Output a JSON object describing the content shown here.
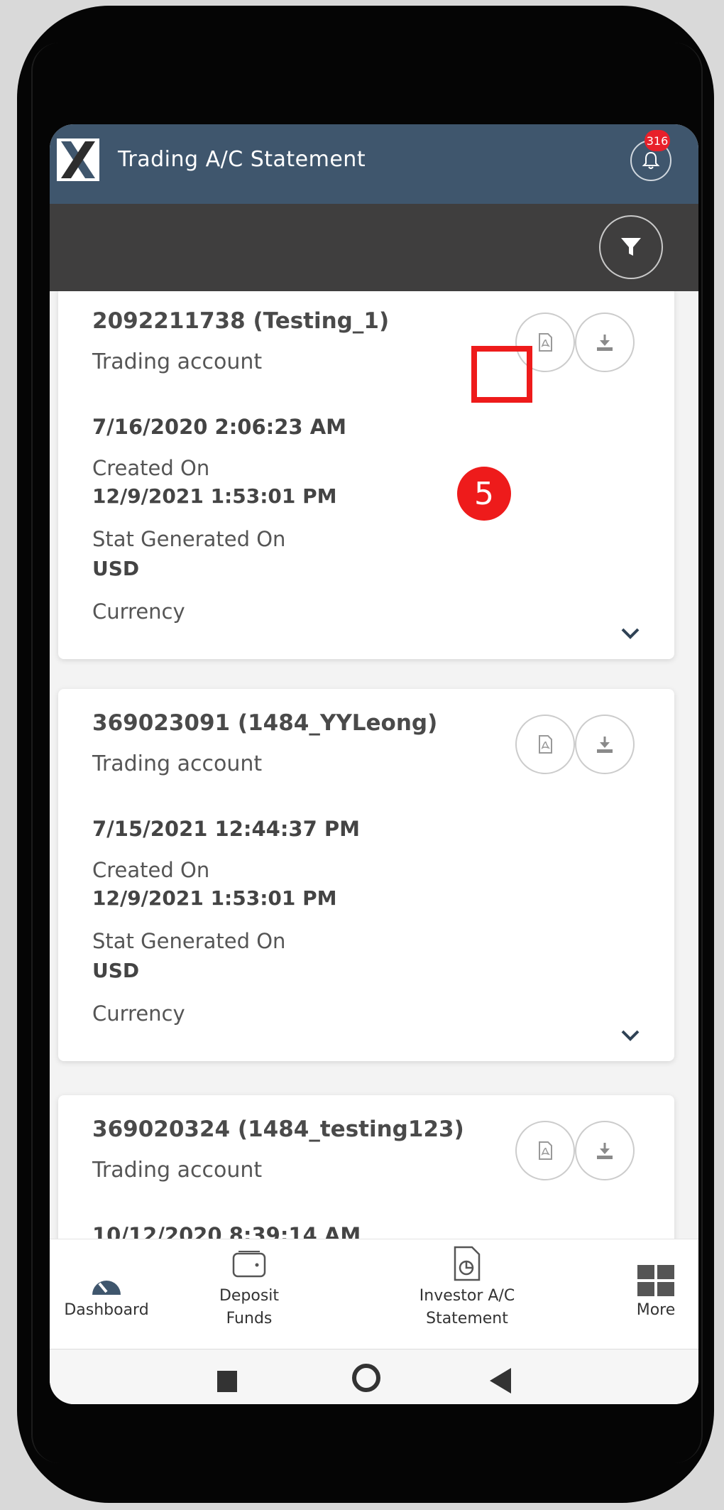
{
  "header": {
    "title": "Trading A/C Statement",
    "notification_count": "316"
  },
  "statements": [
    {
      "account": "2092211738 (Testing_1)",
      "account_type": "Trading account",
      "created_on_value": "7/16/2020 2:06:23 AM",
      "created_on_label": "Created On",
      "generated_on_value": "12/9/2021 1:53:01 PM",
      "generated_on_label": "Stat Generated On",
      "currency_value": "USD",
      "currency_label": "Currency"
    },
    {
      "account": "369023091 (1484_YYLeong)",
      "account_type": "Trading account",
      "created_on_value": "7/15/2021 12:44:37 PM",
      "created_on_label": "Created On",
      "generated_on_value": "12/9/2021 1:53:01 PM",
      "generated_on_label": "Stat Generated On",
      "currency_value": "USD",
      "currency_label": "Currency"
    },
    {
      "account": "369020324 (1484_testing123)",
      "account_type": "Trading account",
      "created_on_value": "10/12/2020 8:39:14 AM"
    }
  ],
  "annotation": {
    "step_number": "5",
    "highlight_color": "#ee1b1b"
  },
  "bottom_nav": [
    {
      "label": "Dashboard",
      "icon": "gauge-icon"
    },
    {
      "label_line1": "Deposit",
      "label_line2": "Funds",
      "icon": "wallet-icon"
    },
    {
      "label_line1": "Investor A/C",
      "label_line2": "Statement",
      "icon": "report-icon"
    },
    {
      "label": "More",
      "icon": "grid-icon"
    }
  ],
  "colors": {
    "app_bar": "#3f566d",
    "filter_bar": "#3f3e3e",
    "badge": "#e8202a"
  }
}
